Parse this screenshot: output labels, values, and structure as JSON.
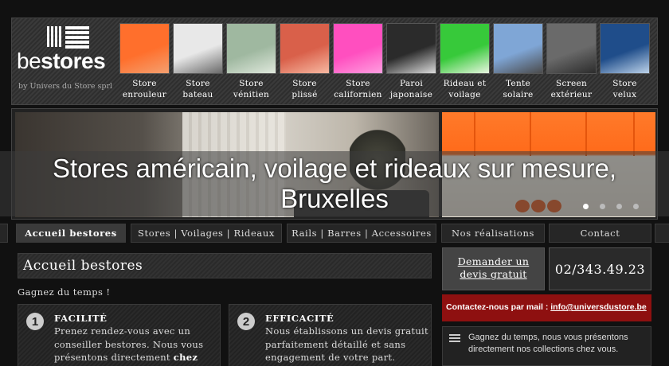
{
  "brand": {
    "name_part1": "be",
    "name_part2": "stores",
    "tagline": "by Univers du Store sprl"
  },
  "products": [
    {
      "line1": "Store",
      "line2": "enrouleur",
      "colors": [
        "#ff6f2c",
        "#f4a070"
      ]
    },
    {
      "line1": "Store",
      "line2": "bateau",
      "colors": [
        "#e8e8e8",
        "#6a6a6a"
      ]
    },
    {
      "line1": "Store",
      "line2": "vénitien",
      "colors": [
        "#9fb8a0",
        "#dfe8dc"
      ]
    },
    {
      "line1": "Store",
      "line2": "plissé",
      "colors": [
        "#d9604a",
        "#f7b9a2"
      ]
    },
    {
      "line1": "Store",
      "line2": "californien",
      "colors": [
        "#ff4fbf",
        "#ff9ee0"
      ]
    },
    {
      "line1": "Paroi",
      "line2": "japonaise",
      "colors": [
        "#2b2b2b",
        "#dcdcdc"
      ]
    },
    {
      "line1": "Rideau et",
      "line2": "voilage",
      "colors": [
        "#37c93a",
        "#e8f5e0"
      ]
    },
    {
      "line1": "Tente",
      "line2": "solaire",
      "colors": [
        "#7fa6d6",
        "#4b4b4b"
      ]
    },
    {
      "line1": "Screen",
      "line2": "extérieur",
      "colors": [
        "#6a6a6a",
        "#2c2c2c"
      ]
    },
    {
      "line1": "Store",
      "line2": "velux",
      "colors": [
        "#1f4d8a",
        "#bdd3ea"
      ]
    }
  ],
  "banner": {
    "caption": "Stores américain, voilage et rideaux sur mesure, Bruxelles",
    "slide_count": 4,
    "active_slide": 1
  },
  "nav": [
    {
      "label": "Accueil bestores",
      "active": true
    },
    {
      "label": "Stores | Voilages | Rideaux",
      "active": false
    },
    {
      "label": "Rails | Barres | Accessoires",
      "active": false
    },
    {
      "label": "Nos réalisations",
      "active": false
    },
    {
      "label": "Contact",
      "active": false
    }
  ],
  "main": {
    "title": "Accueil bestores",
    "intro": "Gagnez du temps !",
    "features": [
      {
        "number": "1",
        "title": "FACILITÉ",
        "body_before": "Prenez rendez-vous avec un conseiller bestores. Nous vous présentons directement ",
        "body_bold": "chez vous"
      },
      {
        "number": "2",
        "title": "EFFICACITÉ",
        "body_before": "Nous établissons un devis gratuit parfaitement détaillé et sans engagement de votre part.",
        "body_bold": ""
      }
    ]
  },
  "sidebar": {
    "quote_button": "Demander un devis gratuit",
    "phone": "02/343.49.23",
    "contact_label": "Contactez-nous par mail : ",
    "contact_email": "info@universdustore.be",
    "info_text": "Gagnez du temps, nous vous présentons directement nos collections chez vous."
  }
}
